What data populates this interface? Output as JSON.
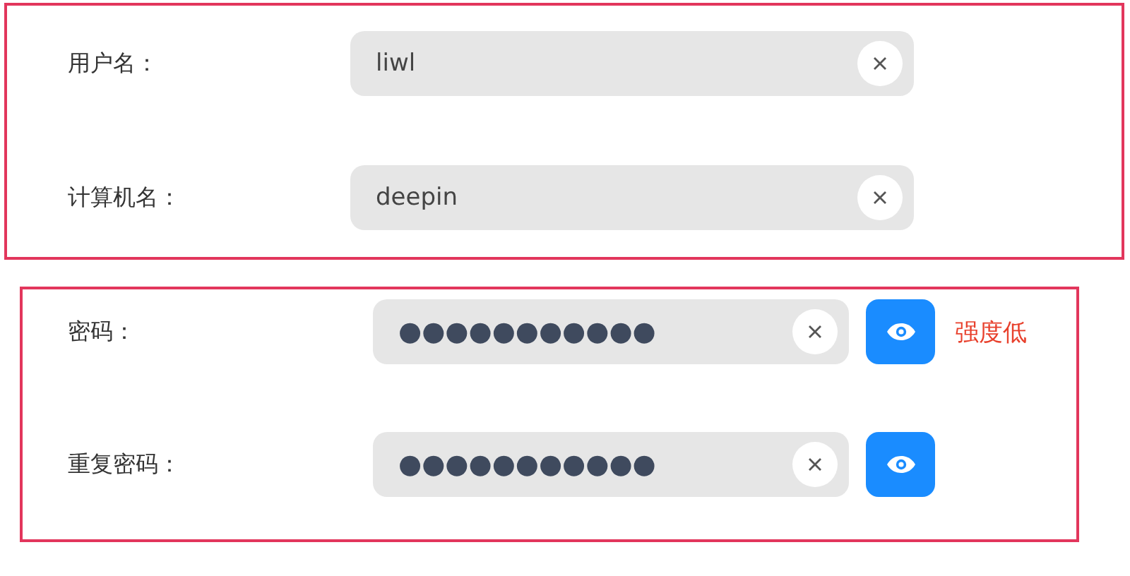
{
  "groups": [
    {
      "fields": [
        {
          "kind": "text",
          "label": "用户名：",
          "value": "liwl"
        },
        {
          "kind": "text",
          "label": "计算机名：",
          "value": "deepin"
        }
      ]
    },
    {
      "fields": [
        {
          "kind": "password",
          "label": "密码：",
          "value": "●●●●●●●●●●●",
          "strength": "强度低"
        },
        {
          "kind": "password",
          "label": "重复密码：",
          "value": "●●●●●●●●●●●"
        }
      ]
    }
  ]
}
